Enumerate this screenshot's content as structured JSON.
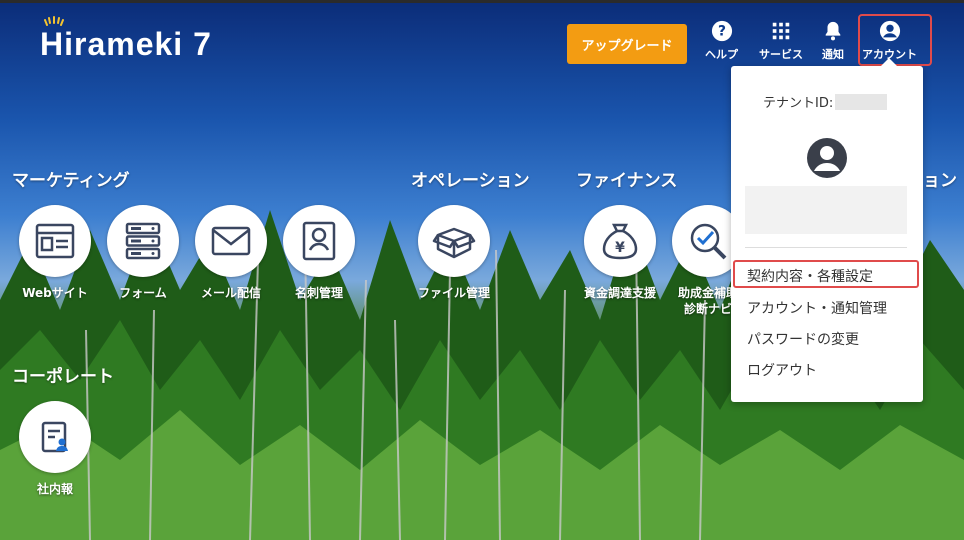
{
  "logo": {
    "text": "Hirameki 7"
  },
  "header": {
    "upgrade_label": "アップグレード",
    "help_label": "ヘルプ",
    "services_label": "サービス",
    "notifications_label": "通知",
    "account_label": "アカウント"
  },
  "sections": {
    "marketing": "マーケティング",
    "operation": "オペレーション",
    "finance": "ファイナンス",
    "hidden_tail": "ョン",
    "corporate": "コーポレート"
  },
  "apps": {
    "web": "Webサイト",
    "form": "フォーム",
    "mail": "メール配信",
    "card": "名刺管理",
    "file": "ファイル管理",
    "funding": "資金調達支援",
    "subsidy_line1": "助成金補助",
    "subsidy_line2": "診断ナビ",
    "news": "社内報"
  },
  "dropdown": {
    "tenant_label": "テナントID:",
    "items": [
      "契約内容・各種設定",
      "アカウント・通知管理",
      "パスワードの変更",
      "ログアウト"
    ]
  },
  "colors": {
    "accent": "#f39c12",
    "highlight": "#e04b4b",
    "icon": "#3a4660"
  }
}
